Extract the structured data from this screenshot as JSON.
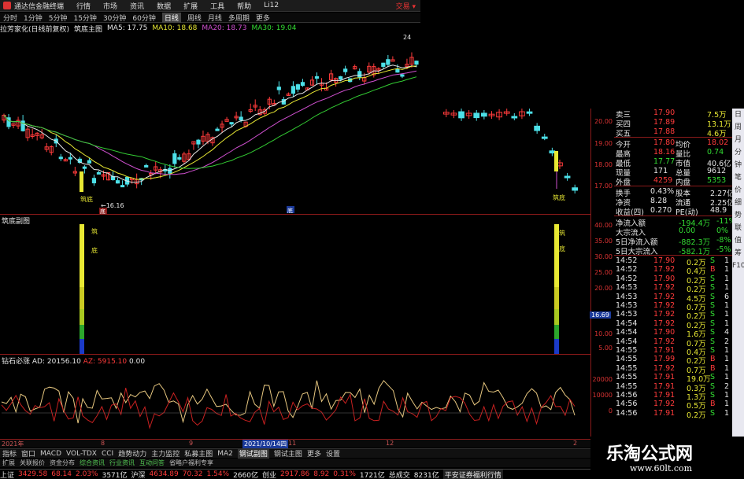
{
  "window": {
    "title": "通达信金融终端",
    "menu": [
      "行情",
      "市场",
      "资讯",
      "数据",
      "扩展",
      "工具",
      "帮助",
      "Li12"
    ],
    "trade": "交易 ▾"
  },
  "toolbar": [
    "分时",
    "1分钟",
    "5分钟",
    "15分钟",
    "30分钟",
    "60分钟",
    "日线",
    "周线",
    "月线",
    "多周期",
    "更多"
  ],
  "main_header": {
    "name": "拉芳家化(日线前复权)",
    "indicator": "筑底主图",
    "ma5": "MA5: 17.75",
    "ma10": "MA10: 18.68",
    "ma20": "MA20: 18.73",
    "ma30": "MA30: 19.04"
  },
  "chart_labels": {
    "low_mark": "16.16",
    "high_mark": "24",
    "signal": "筑底",
    "bottom_note": "底",
    "bottom_note2": "底"
  },
  "axis_main": [
    "20.00",
    "19.00",
    "18.00",
    "17.00"
  ],
  "sub1": {
    "title": "筑底副图",
    "marker_text": "筑\n底",
    "axis": [
      "40.00",
      "35.00",
      "30.00",
      "25.00",
      "20.00",
      "15.00",
      "10.00",
      "5.00"
    ],
    "cursor_value": "16.69"
  },
  "sub2": {
    "title": "钻石必涨",
    "ad": "AD: 20156.10",
    "az": "AZ: 5915.10",
    "z": "0.00",
    "axis": [
      "20000",
      "10000",
      "0"
    ]
  },
  "dates": [
    "2021年",
    "8",
    "9",
    "2021/10/14四",
    "11",
    "12",
    "2"
  ],
  "bottom_tabs": [
    "指标",
    "窗口",
    "MACD",
    "VOL-TDX",
    "CCI",
    "趋势动力",
    "主力监控",
    "私募主图",
    "MA2",
    "钢试副图",
    "钢试主图",
    "更多",
    "设置"
  ],
  "bottom_tabs2": [
    "扩展",
    "关联报价",
    "资金分布",
    "综合资讯",
    "行业资讯",
    "互动问答",
    "省略户福利专享"
  ],
  "status": [
    {
      "label": "上证",
      "value": "3429.58",
      "chg": "68.14",
      "pct": "2.03%",
      "amt": "3571亿"
    },
    {
      "label": "沪深",
      "value": "4634.89",
      "chg": "70.32",
      "pct": "1.54%",
      "amt": "2660亿"
    },
    {
      "label": "创业",
      "value": "2917.86",
      "chg": "8.92",
      "pct": "0.31%",
      "amt": "1721亿"
    },
    {
      "label": "总成交",
      "amt": "8231亿"
    },
    {
      "label": "平安证券福利行情"
    }
  ],
  "quote": {
    "asks": [
      {
        "label": "卖三",
        "price": "17.90",
        "vol": "7.5万"
      },
      {
        "label": "买四",
        "price": "17.89",
        "vol": "13.1万"
      },
      {
        "label": "买五",
        "price": "17.88",
        "vol": "4.6万"
      }
    ],
    "stats": [
      {
        "l1": "今开",
        "v1": "17.80",
        "l2": "均价",
        "v2": "18.02"
      },
      {
        "l1": "最高",
        "v1": "18.16",
        "l2": "量比",
        "v2": "0.74"
      },
      {
        "l1": "最低",
        "v1": "17.77",
        "l2": "市值",
        "v2": "40.6亿"
      },
      {
        "l1": "现量",
        "v1": "171",
        "l2": "总量",
        "v2": "9612"
      },
      {
        "l1": "外盘",
        "v1": "4259",
        "l2": "内盘",
        "v2": "5353"
      }
    ],
    "stats2": [
      {
        "l1": "换手",
        "v1": "0.43%",
        "l2": "股本",
        "v2": "2.27亿"
      },
      {
        "l1": "净资",
        "v1": "8.28",
        "l2": "流通",
        "v2": "2.25亿"
      },
      {
        "l1": "收益(四)",
        "v1": "0.270",
        "l2": "PE(动)",
        "v2": "48.9"
      }
    ],
    "flows": [
      {
        "label": "净流入额",
        "value": "-194.4万",
        "pct": "-11%"
      },
      {
        "label": "大宗流入",
        "value": "0.00",
        "pct": "0%"
      },
      {
        "label": "5日净流入额",
        "value": "-882.3万",
        "pct": "-8%"
      },
      {
        "label": "5日大宗流入",
        "value": "-582.1万",
        "pct": "-5%"
      }
    ],
    "ticks": [
      {
        "t": "14:52",
        "p": "17.90",
        "v": "0.2万",
        "s": "S",
        "n": "1"
      },
      {
        "t": "14:52",
        "p": "17.92",
        "v": "0.4万",
        "s": "B",
        "n": "1"
      },
      {
        "t": "14:52",
        "p": "17.90",
        "v": "0.2万",
        "s": "S",
        "n": "1"
      },
      {
        "t": "14:53",
        "p": "17.92",
        "v": "0.2万",
        "s": "S",
        "n": "1"
      },
      {
        "t": "14:53",
        "p": "17.92",
        "v": "4.5万",
        "s": "S",
        "n": "6"
      },
      {
        "t": "14:53",
        "p": "17.92",
        "v": "0.7万",
        "s": "S",
        "n": "1"
      },
      {
        "t": "14:53",
        "p": "17.92",
        "v": "0.2万",
        "s": "S",
        "n": "1"
      },
      {
        "t": "14:54",
        "p": "17.92",
        "v": "0.2万",
        "s": "S",
        "n": "1"
      },
      {
        "t": "14:54",
        "p": "17.90",
        "v": "1.6万",
        "s": "S",
        "n": "4"
      },
      {
        "t": "14:54",
        "p": "17.92",
        "v": "0.7万",
        "s": "S",
        "n": "2"
      },
      {
        "t": "14:55",
        "p": "17.91",
        "v": "0.4万",
        "s": "S",
        "n": "1"
      },
      {
        "t": "14:55",
        "p": "17.99",
        "v": "0.2万",
        "s": "B",
        "n": "1"
      },
      {
        "t": "14:55",
        "p": "17.92",
        "v": "0.7万",
        "s": "B",
        "n": "1"
      },
      {
        "t": "14:55",
        "p": "17.91",
        "v": "19.0万",
        "s": "S",
        "n": "1"
      },
      {
        "t": "14:55",
        "p": "17.91",
        "v": "0.3万",
        "s": "S",
        "n": "2"
      },
      {
        "t": "14:56",
        "p": "17.91",
        "v": "1.3万",
        "s": "S",
        "n": "1"
      },
      {
        "t": "14:56",
        "p": "17.92",
        "v": "0.5万",
        "s": "B",
        "n": "1"
      },
      {
        "t": "14:56",
        "p": "17.91",
        "v": "0.2万",
        "s": "S",
        "n": "1"
      }
    ]
  },
  "side_tabs": [
    "日",
    "周",
    "月",
    "分",
    "钟",
    "笔",
    "价",
    "细",
    "势",
    "联",
    "值",
    "筹",
    "F10"
  ],
  "watermark": {
    "title": "乐淘公式网",
    "url": "www.60lt.com"
  },
  "ticker_price_axis": [
    "20.00"
  ]
}
